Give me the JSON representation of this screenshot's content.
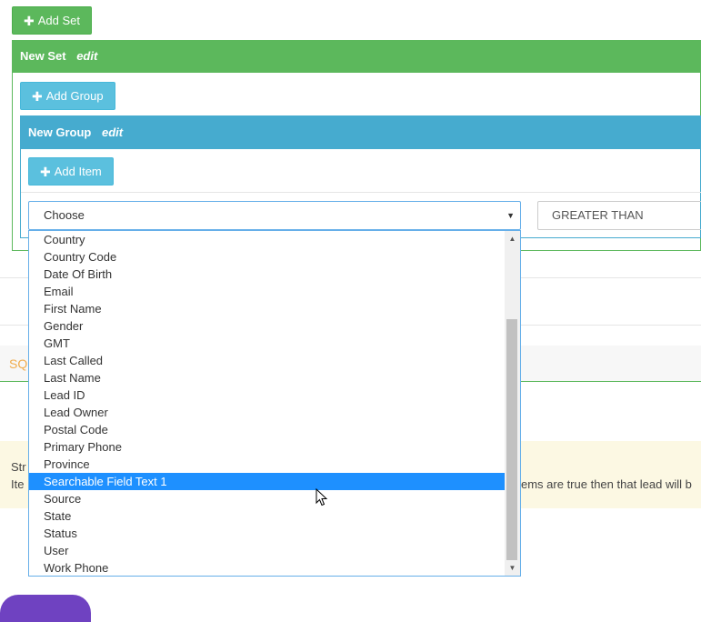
{
  "toolbar": {
    "add_set_label": "Add Set"
  },
  "set": {
    "title": "New Set",
    "edit_label": "edit",
    "add_group_label": "Add Group"
  },
  "group": {
    "title": "New Group",
    "edit_label": "edit",
    "add_item_label": "Add Item"
  },
  "condition": {
    "field_select_value": "Choose",
    "operator_value": "GREATER THAN"
  },
  "field_options": [
    "Country",
    "Country Code",
    "Date Of Birth",
    "Email",
    "First Name",
    "Gender",
    "GMT",
    "Last Called",
    "Last Name",
    "Lead ID",
    "Lead Owner",
    "Postal Code",
    "Primary Phone",
    "Province",
    "Searchable Field Text 1",
    "Source",
    "State",
    "Status",
    "User",
    "Work Phone"
  ],
  "highlighted_option": "Searchable Field Text 1",
  "sql_tab_label": "SQL",
  "info": {
    "line1_start": "Str",
    "line2_start": "Ite",
    "line2_end": "ems are true then that lead will b"
  },
  "colors": {
    "set": "#5cb85c",
    "group": "#46abcf",
    "highlight": "#1e90ff",
    "sql_tab": "#f0ad4e"
  },
  "icons": {
    "plus": "plus-icon",
    "dropdown_arrow": "caret-down-icon",
    "cursor": "mouse-pointer-icon"
  }
}
